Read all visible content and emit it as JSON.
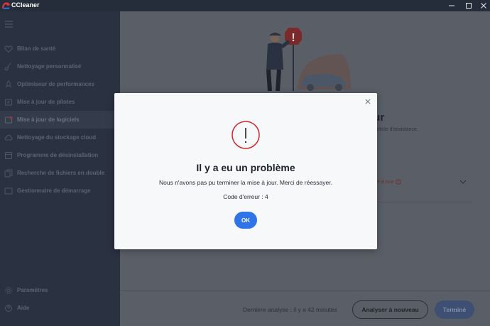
{
  "window": {
    "title": "CCleaner"
  },
  "sidebar": {
    "items": [
      {
        "label": "Bilan de santé",
        "icon": "heart-icon"
      },
      {
        "label": "Nettoyage personnalisé",
        "icon": "broom-icon"
      },
      {
        "label": "Optimiseur de performances",
        "icon": "rocket-icon"
      },
      {
        "label": "Mise à jour de pilotes",
        "icon": "driver-icon"
      },
      {
        "label": "Mise à jour de logiciels",
        "icon": "software-update-icon",
        "active": true
      },
      {
        "label": "Nettoyage du stockage cloud",
        "icon": "cloud-icon"
      },
      {
        "label": "Programme de désinstallation",
        "icon": "uninstall-icon"
      },
      {
        "label": "Recherche de fichiers en double",
        "icon": "duplicate-files-icon"
      },
      {
        "label": "Gestionnaire de démarrage",
        "icon": "startup-icon"
      }
    ],
    "bottom": [
      {
        "label": "Paramètres",
        "icon": "gear-icon"
      },
      {
        "label": "Aide",
        "icon": "help-icon"
      }
    ]
  },
  "main": {
    "heading_partial": "our",
    "sub_partial": "otre article d'assistance.",
    "row_partial": "ettre à jour",
    "footer": {
      "status": "Dernière analyse : il y a 42 minutes",
      "rescan_label": "Analyser à nouveau",
      "done_label": "Terminé"
    }
  },
  "dialog": {
    "title": "Il y a eu un problème",
    "message": "Nous n'avons pas pu terminer la mise à jour. Merci de réessayer.",
    "error_code": "Code d'erreur : 4",
    "ok_label": "OK"
  },
  "colors": {
    "accent": "#2f73e8",
    "error": "#d0262b",
    "sidebar_bg": "#2a3140",
    "dialog_bg": "#f7f8fa"
  }
}
